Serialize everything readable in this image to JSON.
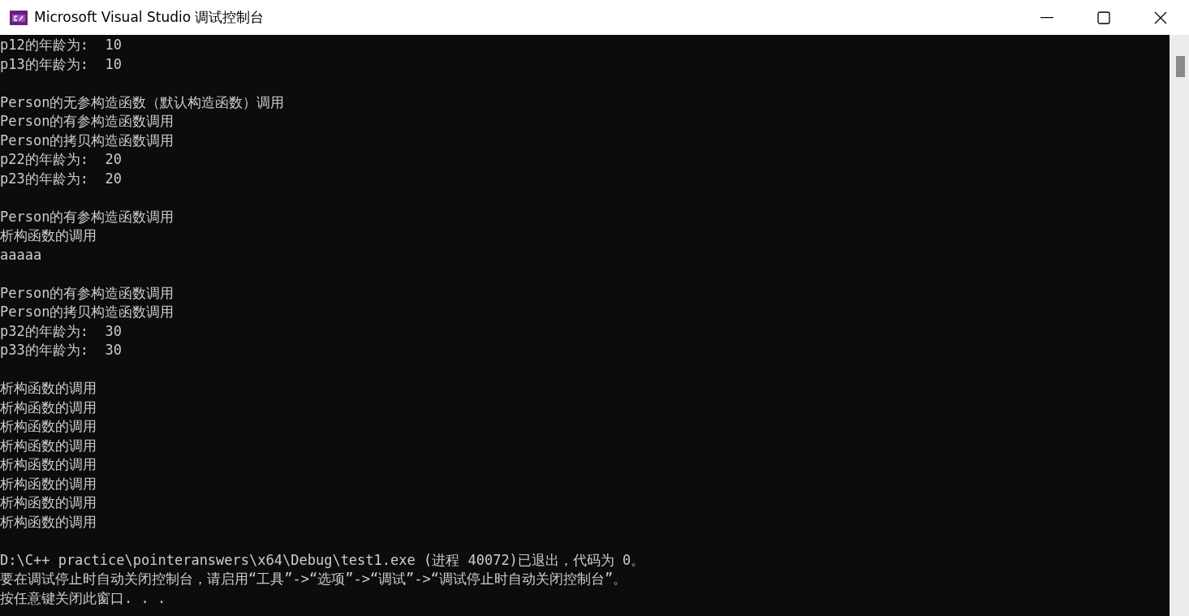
{
  "window": {
    "title": "Microsoft Visual Studio 调试控制台"
  },
  "console": {
    "blocks": [
      {
        "lines": [
          "p12的年龄为:  10",
          "p13的年龄为:  10"
        ]
      },
      {
        "lines": [
          "Person的无参构造函数（默认构造函数）调用",
          "Person的有参构造函数调用",
          "Person的拷贝构造函数调用",
          "p22的年龄为:  20",
          "p23的年龄为:  20"
        ]
      },
      {
        "lines": [
          "Person的有参构造函数调用",
          "析构函数的调用",
          "aaaaa"
        ]
      },
      {
        "lines": [
          "Person的有参构造函数调用",
          "Person的拷贝构造函数调用",
          "p32的年龄为:  30",
          "p33的年龄为:  30"
        ]
      },
      {
        "lines": [
          "析构函数的调用",
          "析构函数的调用",
          "析构函数的调用",
          "析构函数的调用",
          "析构函数的调用",
          "析构函数的调用",
          "析构函数的调用",
          "析构函数的调用"
        ]
      },
      {
        "lines": [
          "D:\\C++ practice\\pointeranswers\\x64\\Debug\\test1.exe (进程 40072)已退出，代码为 0。",
          "要在调试停止时自动关闭控制台，请启用“工具”->“选项”->“调试”->“调试停止时自动关闭控制台”。",
          "按任意键关闭此窗口. . ."
        ]
      }
    ]
  }
}
